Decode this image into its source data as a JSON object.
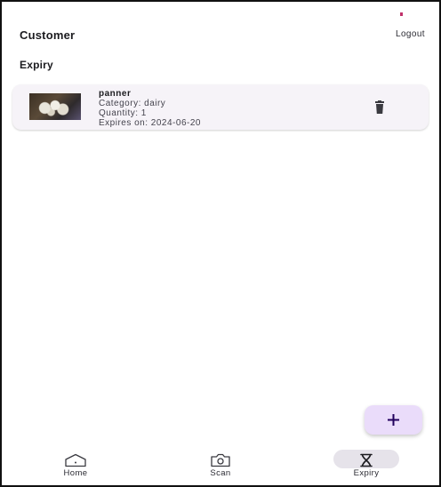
{
  "appbar": {
    "title": "Customer",
    "logout_label": "Logout"
  },
  "section": {
    "title": "Expiry"
  },
  "items": [
    {
      "name": "panner",
      "category": "Category: dairy",
      "quantity": "Quantity: 1",
      "expires": "Expires on: 2024-06-20"
    }
  ],
  "fab": {
    "icon": "plus-icon"
  },
  "nav": {
    "items": [
      {
        "label": "Home",
        "icon": "home-icon",
        "active": false
      },
      {
        "label": "Scan",
        "icon": "camera-icon",
        "active": false
      },
      {
        "label": "Expiry",
        "icon": "hourglass-icon",
        "active": true
      }
    ]
  },
  "colors": {
    "card_bg": "#f6f3f8",
    "fab_bg": "#eadcfa",
    "nav_active_pill": "#e6e3ea",
    "status_dot": "#c0306a"
  }
}
